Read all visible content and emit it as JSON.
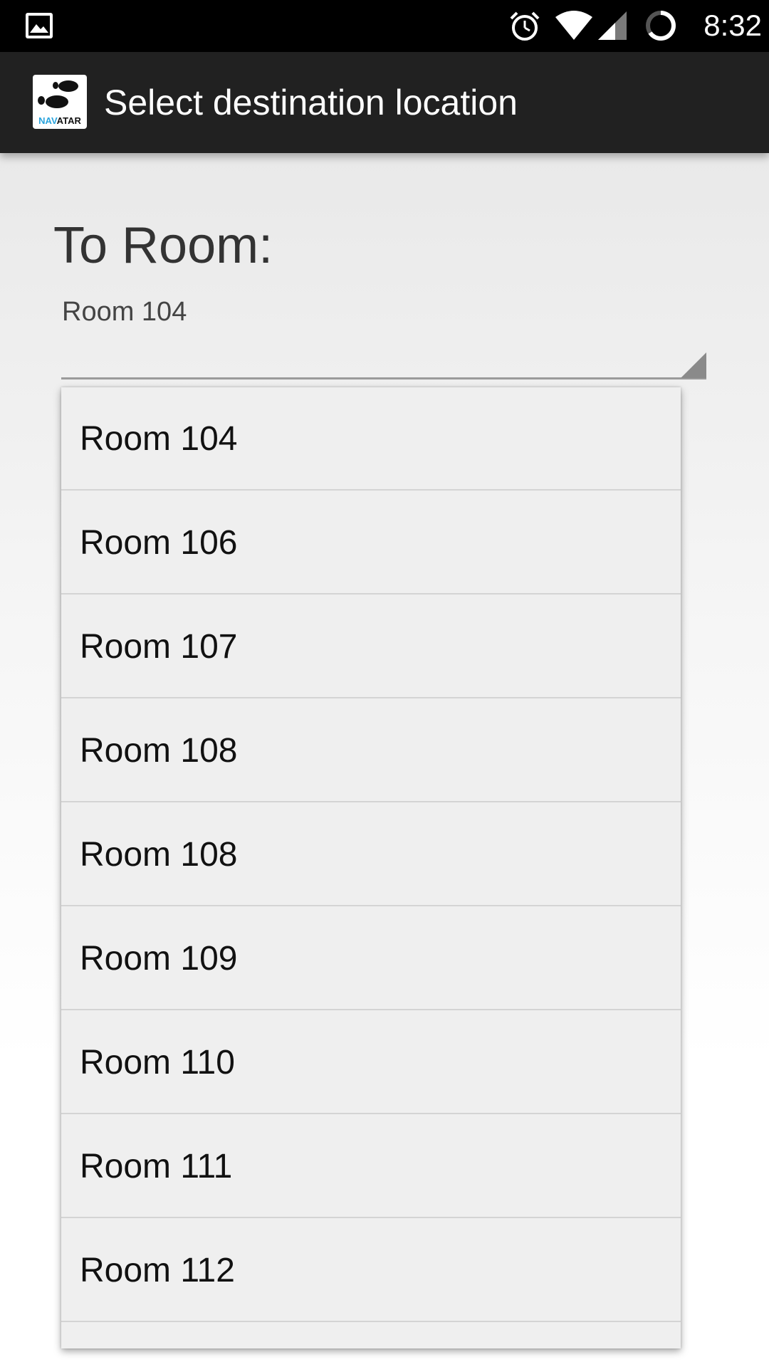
{
  "status_bar": {
    "time": "8:32",
    "icons": [
      "gallery-icon",
      "alarm-icon",
      "wifi-icon",
      "signal-icon",
      "battery-icon"
    ]
  },
  "action_bar": {
    "logo_text_nav": "NAV",
    "logo_text_atar": "ATAR",
    "title": "Select destination location",
    "background": "#212121"
  },
  "form": {
    "heading": "To Room:",
    "selected_room": "Room 104"
  },
  "dropdown": {
    "items": [
      {
        "label": "Room 104"
      },
      {
        "label": "Room 106"
      },
      {
        "label": "Room 107"
      },
      {
        "label": "Room 108"
      },
      {
        "label": "Room 108"
      },
      {
        "label": "Room 109"
      },
      {
        "label": "Room 110"
      },
      {
        "label": "Room 111"
      },
      {
        "label": "Room 112"
      }
    ]
  },
  "colors": {
    "logo_accent": "#2aa4dd",
    "list_background": "#efefef"
  }
}
